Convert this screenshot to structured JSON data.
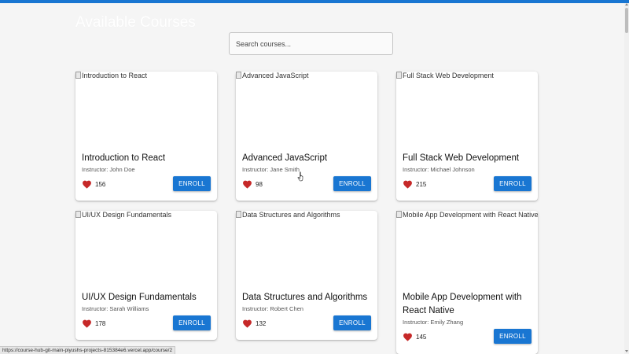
{
  "header": {
    "title": "Available Courses"
  },
  "search": {
    "placeholder": "Search courses..."
  },
  "colors": {
    "accent": "#1976d2",
    "heart": "#c62828",
    "page_bg": "#f5f5f5"
  },
  "courses": [
    {
      "image_alt": "Introduction to React",
      "title": "Introduction to React",
      "instructor": "Instructor: John Doe",
      "likes": "156",
      "button": "ENROLL"
    },
    {
      "image_alt": "Advanced JavaScript",
      "title": "Advanced JavaScript",
      "instructor": "Instructor: Jane Smith",
      "likes": "98",
      "button": "ENROLL"
    },
    {
      "image_alt": "Full Stack Web Development",
      "title": "Full Stack Web Development",
      "instructor": "Instructor: Michael Johnson",
      "likes": "215",
      "button": "ENROLL"
    },
    {
      "image_alt": "UI/UX Design Fundamentals",
      "title": "UI/UX Design Fundamentals",
      "instructor": "Instructor: Sarah Williams",
      "likes": "178",
      "button": "ENROLL"
    },
    {
      "image_alt": "Data Structures and Algorithms",
      "title": "Data Structures and Algorithms",
      "instructor": "Instructor: Robert Chen",
      "likes": "132",
      "button": "ENROLL"
    },
    {
      "image_alt": "Mobile App Development with React Native",
      "title": "Mobile App Development with React Native",
      "instructor": "Instructor: Emily Zhang",
      "likes": "145",
      "button": "ENROLL"
    }
  ],
  "status_url": "https://course-hub-git-main-piyushs-projects-815384e6.vercel.app/course/2"
}
